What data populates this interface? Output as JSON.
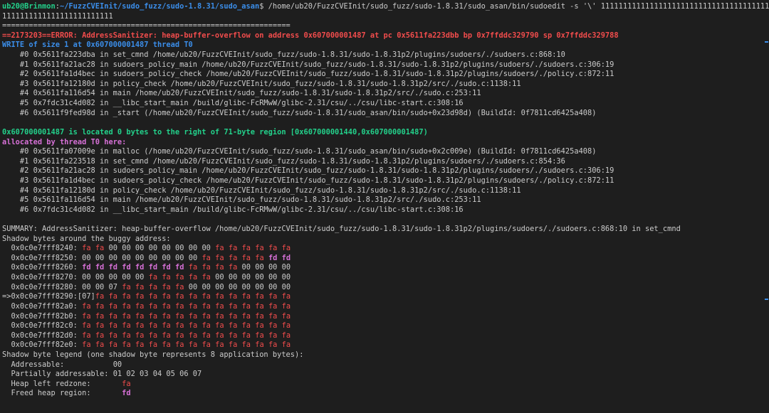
{
  "terminal": {
    "prompt": {
      "userhost": "ub20@Brinmon",
      "path": "~/FuzzCVEInit/sudo_fuzz/sudo-1.8.31/sudo_asan",
      "command": " /home/ub20/FuzzCVEInit/sudo_fuzz/sudo-1.8.31/sudo_asan/bin/sudoedit -s '\\' 1111111111111111111111111111111111111111111111",
      "command_cont": "1111111111111111111111111"
    },
    "separator": "=================================================================",
    "error_line": "==2173203==ERROR: AddressSanitizer: heap-buffer-overflow on address 0x607000001487 at pc 0x5611fa223dbb bp 0x7ffddc329790 sp 0x7ffddc329788",
    "write_line": "WRITE of size 1 at 0x607000001487 thread T0",
    "write_frames": [
      "    #0 0x5611fa223dba in set_cmnd /home/ub20/FuzzCVEInit/sudo_fuzz/sudo-1.8.31/sudo-1.8.31p2/plugins/sudoers/./sudoers.c:868:10",
      "    #1 0x5611fa21ac28 in sudoers_policy_main /home/ub20/FuzzCVEInit/sudo_fuzz/sudo-1.8.31/sudo-1.8.31p2/plugins/sudoers/./sudoers.c:306:19",
      "    #2 0x5611fa1d4bec in sudoers_policy_check /home/ub20/FuzzCVEInit/sudo_fuzz/sudo-1.8.31/sudo-1.8.31p2/plugins/sudoers/./policy.c:872:11",
      "    #3 0x5611fa12180d in policy_check /home/ub20/FuzzCVEInit/sudo_fuzz/sudo-1.8.31/sudo-1.8.31p2/src/./sudo.c:1138:11",
      "    #4 0x5611fa116d54 in main /home/ub20/FuzzCVEInit/sudo_fuzz/sudo-1.8.31/sudo-1.8.31p2/src/./sudo.c:253:11",
      "    #5 0x7fdc31c4d082 in __libc_start_main /build/glibc-FcRMwW/glibc-2.31/csu/../csu/libc-start.c:308:16",
      "    #6 0x5611f9fed98d in _start (/home/ub20/FuzzCVEInit/sudo_fuzz/sudo-1.8.31/sudo_asan/bin/sudo+0x23d98d) (BuildId: 0f7811cd6425a408)"
    ],
    "located_line": "0x607000001487 is located 0 bytes to the right of 71-byte region [0x607000001440,0x607000001487)",
    "allocated_line": "allocated by thread T0 here:",
    "alloc_frames": [
      "    #0 0x5611fa07009e in malloc (/home/ub20/FuzzCVEInit/sudo_fuzz/sudo-1.8.31/sudo_asan/bin/sudo+0x2c009e) (BuildId: 0f7811cd6425a408)",
      "    #1 0x5611fa223518 in set_cmnd /home/ub20/FuzzCVEInit/sudo_fuzz/sudo-1.8.31/sudo-1.8.31p2/plugins/sudoers/./sudoers.c:854:36",
      "    #2 0x5611fa21ac28 in sudoers_policy_main /home/ub20/FuzzCVEInit/sudo_fuzz/sudo-1.8.31/sudo-1.8.31p2/plugins/sudoers/./sudoers.c:306:19",
      "    #3 0x5611fa1d4bec in sudoers_policy_check /home/ub20/FuzzCVEInit/sudo_fuzz/sudo-1.8.31/sudo-1.8.31p2/plugins/sudoers/./policy.c:872:11",
      "    #4 0x5611fa12180d in policy_check /home/ub20/FuzzCVEInit/sudo_fuzz/sudo-1.8.31/sudo-1.8.31p2/src/./sudo.c:1138:11",
      "    #5 0x5611fa116d54 in main /home/ub20/FuzzCVEInit/sudo_fuzz/sudo-1.8.31/sudo-1.8.31p2/src/./sudo.c:253:11",
      "    #6 0x7fdc31c4d082 in __libc_start_main /build/glibc-FcRMwW/glibc-2.31/csu/../csu/libc-start.c:308:16"
    ],
    "summary_line": "SUMMARY: AddressSanitizer: heap-buffer-overflow /home/ub20/FuzzCVEInit/sudo_fuzz/sudo-1.8.31/sudo-1.8.31p2/plugins/sudoers/./sudoers.c:868:10 in set_cmnd",
    "shadow_header": "Shadow bytes around the buggy address:",
    "shadow_rows": [
      {
        "prefix": "  0x0c0e7fff8240: ",
        "bytes": [
          "fa",
          "fa",
          "00",
          "00",
          "00",
          "00",
          "00",
          "00",
          "00",
          "00",
          "fa",
          "fa",
          "fa",
          "fa",
          "fa",
          "fa"
        ]
      },
      {
        "prefix": "  0x0c0e7fff8250: ",
        "bytes": [
          "00",
          "00",
          "00",
          "00",
          "00",
          "00",
          "00",
          "00",
          "00",
          "fa",
          "fa",
          "fa",
          "fa",
          "fa",
          "fd",
          "fd"
        ]
      },
      {
        "prefix": "  0x0c0e7fff8260: ",
        "bytes": [
          "fd",
          "fd",
          "fd",
          "fd",
          "fd",
          "fd",
          "fd",
          "fd",
          "fa",
          "fa",
          "fa",
          "fa",
          "00",
          "00",
          "00",
          "00"
        ]
      },
      {
        "prefix": "  0x0c0e7fff8270: ",
        "bytes": [
          "00",
          "00",
          "00",
          "00",
          "00",
          "fa",
          "fa",
          "fa",
          "fa",
          "fa",
          "00",
          "00",
          "00",
          "00",
          "00",
          "00"
        ]
      },
      {
        "prefix": "  0x0c0e7fff8280: ",
        "bytes": [
          "00",
          "00",
          "07",
          "fa",
          "fa",
          "fa",
          "fa",
          "fa",
          "00",
          "00",
          "00",
          "00",
          "00",
          "00",
          "00",
          "00"
        ]
      },
      {
        "prefix": "=>0x0c0e7fff8290:",
        "bracket": "[07]",
        "bytes": [
          "fa",
          "fa",
          "fa",
          "fa",
          "fa",
          "fa",
          "fa",
          "fa",
          "fa",
          "fa",
          "fa",
          "fa",
          "fa",
          "fa",
          "fa"
        ]
      },
      {
        "prefix": "  0x0c0e7fff82a0: ",
        "bytes": [
          "fa",
          "fa",
          "fa",
          "fa",
          "fa",
          "fa",
          "fa",
          "fa",
          "fa",
          "fa",
          "fa",
          "fa",
          "fa",
          "fa",
          "fa",
          "fa"
        ]
      },
      {
        "prefix": "  0x0c0e7fff82b0: ",
        "bytes": [
          "fa",
          "fa",
          "fa",
          "fa",
          "fa",
          "fa",
          "fa",
          "fa",
          "fa",
          "fa",
          "fa",
          "fa",
          "fa",
          "fa",
          "fa",
          "fa"
        ]
      },
      {
        "prefix": "  0x0c0e7fff82c0: ",
        "bytes": [
          "fa",
          "fa",
          "fa",
          "fa",
          "fa",
          "fa",
          "fa",
          "fa",
          "fa",
          "fa",
          "fa",
          "fa",
          "fa",
          "fa",
          "fa",
          "fa"
        ]
      },
      {
        "prefix": "  0x0c0e7fff82d0: ",
        "bytes": [
          "fa",
          "fa",
          "fa",
          "fa",
          "fa",
          "fa",
          "fa",
          "fa",
          "fa",
          "fa",
          "fa",
          "fa",
          "fa",
          "fa",
          "fa",
          "fa"
        ]
      },
      {
        "prefix": "  0x0c0e7fff82e0: ",
        "bytes": [
          "fa",
          "fa",
          "fa",
          "fa",
          "fa",
          "fa",
          "fa",
          "fa",
          "fa",
          "fa",
          "fa",
          "fa",
          "fa",
          "fa",
          "fa",
          "fa"
        ]
      }
    ],
    "legend_header": "Shadow byte legend (one shadow byte represents 8 application bytes):",
    "legend": [
      {
        "label": "  Addressable:           ",
        "value": "00",
        "color": "fg"
      },
      {
        "label": "  Partially addressable: ",
        "value": "01 02 03 04 05 06 07",
        "color": "fg"
      },
      {
        "label": "  Heap left redzone:       ",
        "value": "fa",
        "color": "red"
      },
      {
        "label": "  Freed heap region:       ",
        "value": "fd",
        "color": "mag"
      }
    ],
    "colors": {
      "background": "#1e1e1e",
      "foreground": "#cccccc",
      "green": "#23d18b",
      "blue": "#3b8eea",
      "red": "#f14c4c",
      "magenta": "#d670d6"
    }
  }
}
